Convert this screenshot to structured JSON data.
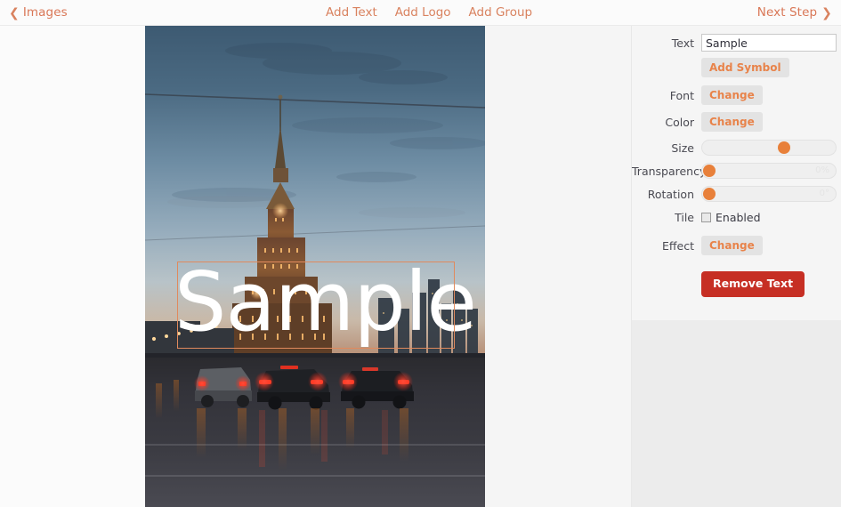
{
  "topbar": {
    "back_label": "Images",
    "back_icon": "chevron-left-icon",
    "next_label": "Next Step",
    "next_icon": "chevron-right-icon",
    "center_items": [
      {
        "label": "Add Text"
      },
      {
        "label": "Add Logo"
      },
      {
        "label": "Add Group"
      }
    ]
  },
  "canvas": {
    "watermark": {
      "text": "Sample",
      "color": "#ffffff",
      "selection_border_color": "#e08a5d"
    },
    "photo_alt": "city skyline at dusk with cars on a wet road"
  },
  "panel": {
    "text": {
      "label": "Text",
      "value": "Sample",
      "placeholder": "Text"
    },
    "add_symbol": {
      "label": "Add Symbol"
    },
    "font": {
      "label": "Font",
      "button": "Change"
    },
    "color": {
      "label": "Color",
      "button": "Change"
    },
    "size": {
      "label": "Size",
      "value": "",
      "handle_percent": 62
    },
    "transparency": {
      "label": "Transparency",
      "value": "0%",
      "handle_percent": 0
    },
    "rotation": {
      "label": "Rotation",
      "value": "0°",
      "handle_percent": 0
    },
    "tile": {
      "label": "Tile",
      "checkbox_label": "Enabled",
      "checked": false
    },
    "effect": {
      "label": "Effect",
      "button": "Change"
    },
    "remove": {
      "label": "Remove Text"
    }
  },
  "colors": {
    "accent": "#e8834a",
    "link": "#d9825f",
    "danger": "#c62f24",
    "panel_bg": "#f5f5f5"
  }
}
